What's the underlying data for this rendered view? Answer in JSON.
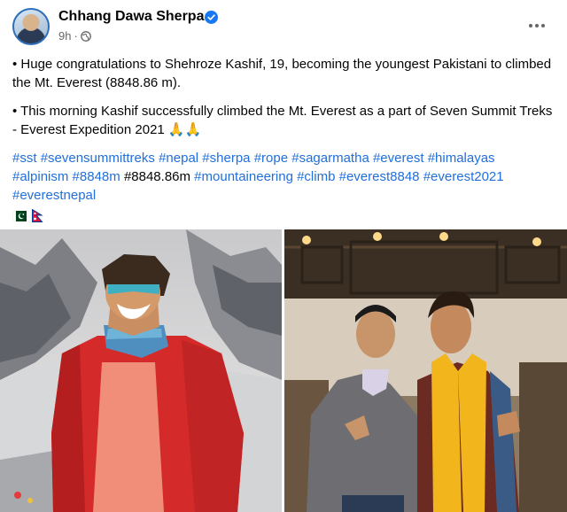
{
  "post": {
    "author": "Chhang Dawa Sherpa",
    "time": "9h",
    "paragraph1": "• Huge congratulations to Shehroze Kashif, 19, becoming the youngest Pakistani to climbed the Mt. Everest (8848.86 m).",
    "paragraph2": "• This morning Kashif successfully climbed the Mt. Everest as a part of Seven Summit Treks - Everest Expedition 2021 🙏🙏",
    "hashtags": [
      "#sst",
      "#sevensummittreks",
      "#nepal",
      "#sherpa",
      "#rope",
      "#sagarmatha",
      "#everest",
      "#himalayas",
      "#alpinism",
      "#8848m",
      "#8848.86m",
      "#mountaineering",
      "#climb",
      "#everest8848",
      "#everest2021",
      "#everestnepal"
    ],
    "plain_hashtag": "#8848.86m",
    "flags": [
      "pakistan-flag",
      "nepal-flag"
    ]
  },
  "icons": {
    "verified": "verified-badge-icon",
    "privacy": "globe-icon",
    "more": "more-options-icon"
  },
  "colors": {
    "link": "#216fdb",
    "verified": "#1877f2",
    "meta": "#65676b",
    "jacket": "#d42a2a",
    "scarf": "#f2b51c"
  }
}
